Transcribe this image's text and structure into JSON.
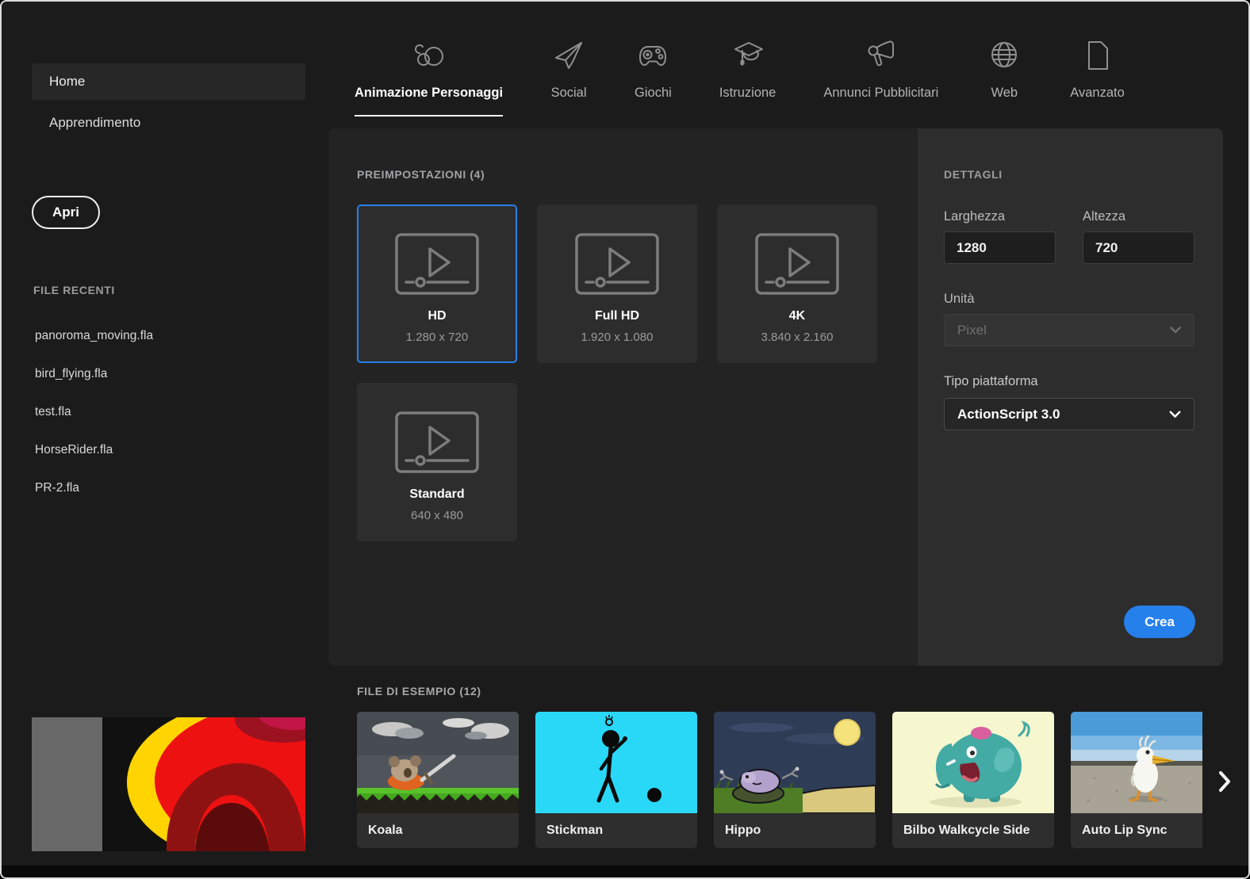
{
  "colors": {
    "accent": "#2680eb",
    "tab_underline": "#f2f2f2",
    "stickman_bg": "#29d8f7"
  },
  "sidebar": {
    "items": [
      {
        "label": "Home",
        "selected": true
      },
      {
        "label": "Apprendimento",
        "selected": false
      }
    ],
    "open_button": "Apri",
    "recent_header": "FILE RECENTI",
    "recent_files": [
      "panoroma_moving.fla",
      "bird_flying.fla",
      "test.fla",
      "HorseRider.fla",
      "PR-2.fla"
    ],
    "thumbnail": "screaming-red-face-preview"
  },
  "tabs": [
    {
      "label": "Animazione Personaggi",
      "icon": "character-animation-icon",
      "active": true
    },
    {
      "label": "Social",
      "icon": "paper-plane-icon",
      "active": false
    },
    {
      "label": "Giochi",
      "icon": "gamepad-icon",
      "active": false
    },
    {
      "label": "Istruzione",
      "icon": "graduation-cap-icon",
      "active": false
    },
    {
      "label": "Annunci Pubblicitari",
      "icon": "megaphone-icon",
      "active": false
    },
    {
      "label": "Web",
      "icon": "globe-icon",
      "active": false
    },
    {
      "label": "Avanzato",
      "icon": "document-icon",
      "active": false
    }
  ],
  "presets": {
    "header": "PREIMPOSTAZIONI (4)",
    "items": [
      {
        "name": "HD",
        "size": "1.280 x 720",
        "selected": true
      },
      {
        "name": "Full HD",
        "size": "1.920 x 1.080",
        "selected": false
      },
      {
        "name": "4K",
        "size": "3.840 x 2.160",
        "selected": false
      },
      {
        "name": "Standard",
        "size": "640 x 480",
        "selected": false
      }
    ]
  },
  "details": {
    "header": "DETTAGLI",
    "width_label": "Larghezza",
    "width_value": "1280",
    "height_label": "Altezza",
    "height_value": "720",
    "unit_label": "Unità",
    "unit_value": "Pixel",
    "platform_label": "Tipo piattaforma",
    "platform_value": "ActionScript 3.0",
    "create_button": "Crea"
  },
  "samples": {
    "header": "FILE DI ESEMPIO (12)",
    "items": [
      {
        "label": "Koala"
      },
      {
        "label": "Stickman"
      },
      {
        "label": "Hippo"
      },
      {
        "label": "Bilbo Walkcycle Side"
      },
      {
        "label": "Auto Lip Sync"
      }
    ],
    "next_control": "next-arrow"
  }
}
